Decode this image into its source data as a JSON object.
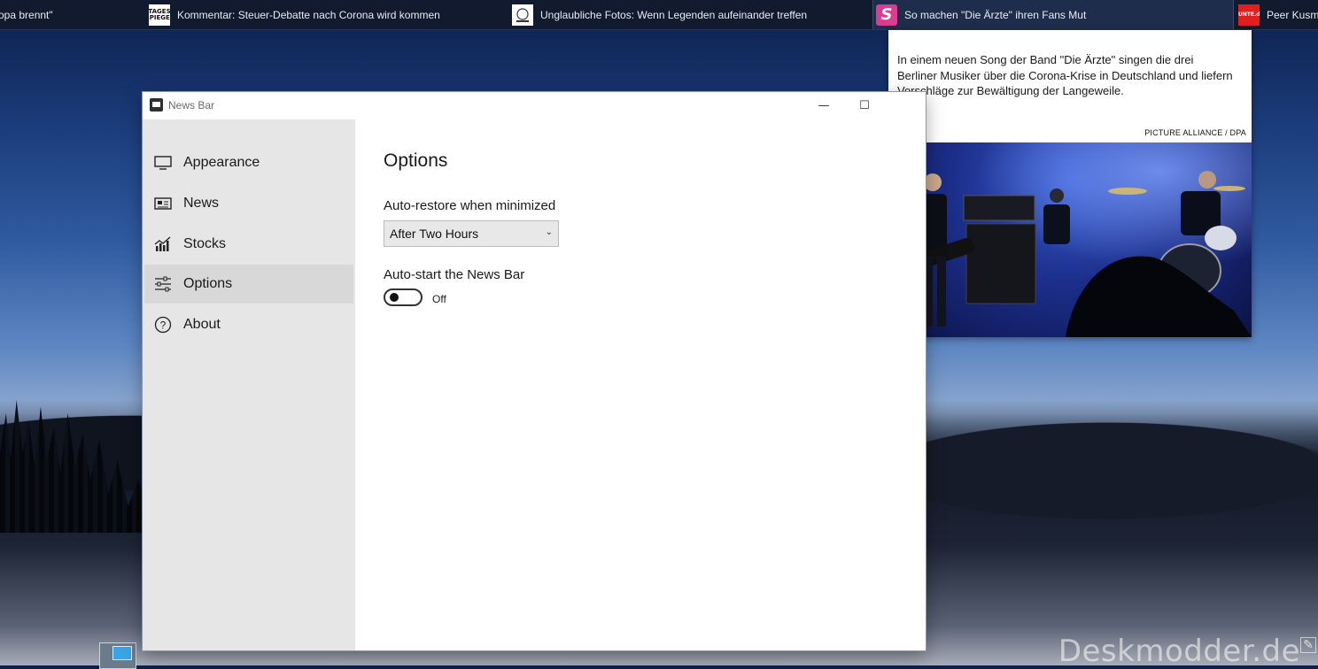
{
  "newsbar": {
    "items": [
      {
        "text": "opa brennt\"",
        "logo": ""
      },
      {
        "text": "Kommentar:  Steuer-Debatte nach Corona wird kommen",
        "logo": "TAGES SPIEGEL"
      },
      {
        "text": "Unglaubliche Fotos: Wenn Legenden aufeinander treffen",
        "logo": ""
      },
      {
        "text": "So machen \"Die Ärzte\" ihren Fans Mut",
        "logo": "S"
      },
      {
        "text": "Peer Kusma",
        "logo": ""
      }
    ]
  },
  "popup": {
    "text": "In einem neuen Song der Band \"Die Ärzte\" singen die drei Berliner Musiker über die Corona-Krise in Deutschland und liefern Vorschläge zur Bewältigung der Langeweile.",
    "credit": "PICTURE ALLIANCE / DPA"
  },
  "window": {
    "title": "News Bar",
    "minimize_glyph": "—",
    "maximize_glyph": "☐"
  },
  "sidebar": {
    "items": [
      {
        "label": "Appearance",
        "icon": "monitor-icon"
      },
      {
        "label": "News",
        "icon": "newspaper-icon"
      },
      {
        "label": "Stocks",
        "icon": "chart-icon"
      },
      {
        "label": "Options",
        "icon": "sliders-icon",
        "selected": true
      },
      {
        "label": "About",
        "icon": "help-circle-icon"
      }
    ]
  },
  "options": {
    "title": "Options",
    "auto_restore_label": "Auto-restore when minimized",
    "auto_restore_value": "After Two Hours",
    "auto_start_label": "Auto-start the News Bar",
    "auto_start_state": "Off"
  },
  "desktop": {
    "watermark": "Deskmodder.de"
  }
}
